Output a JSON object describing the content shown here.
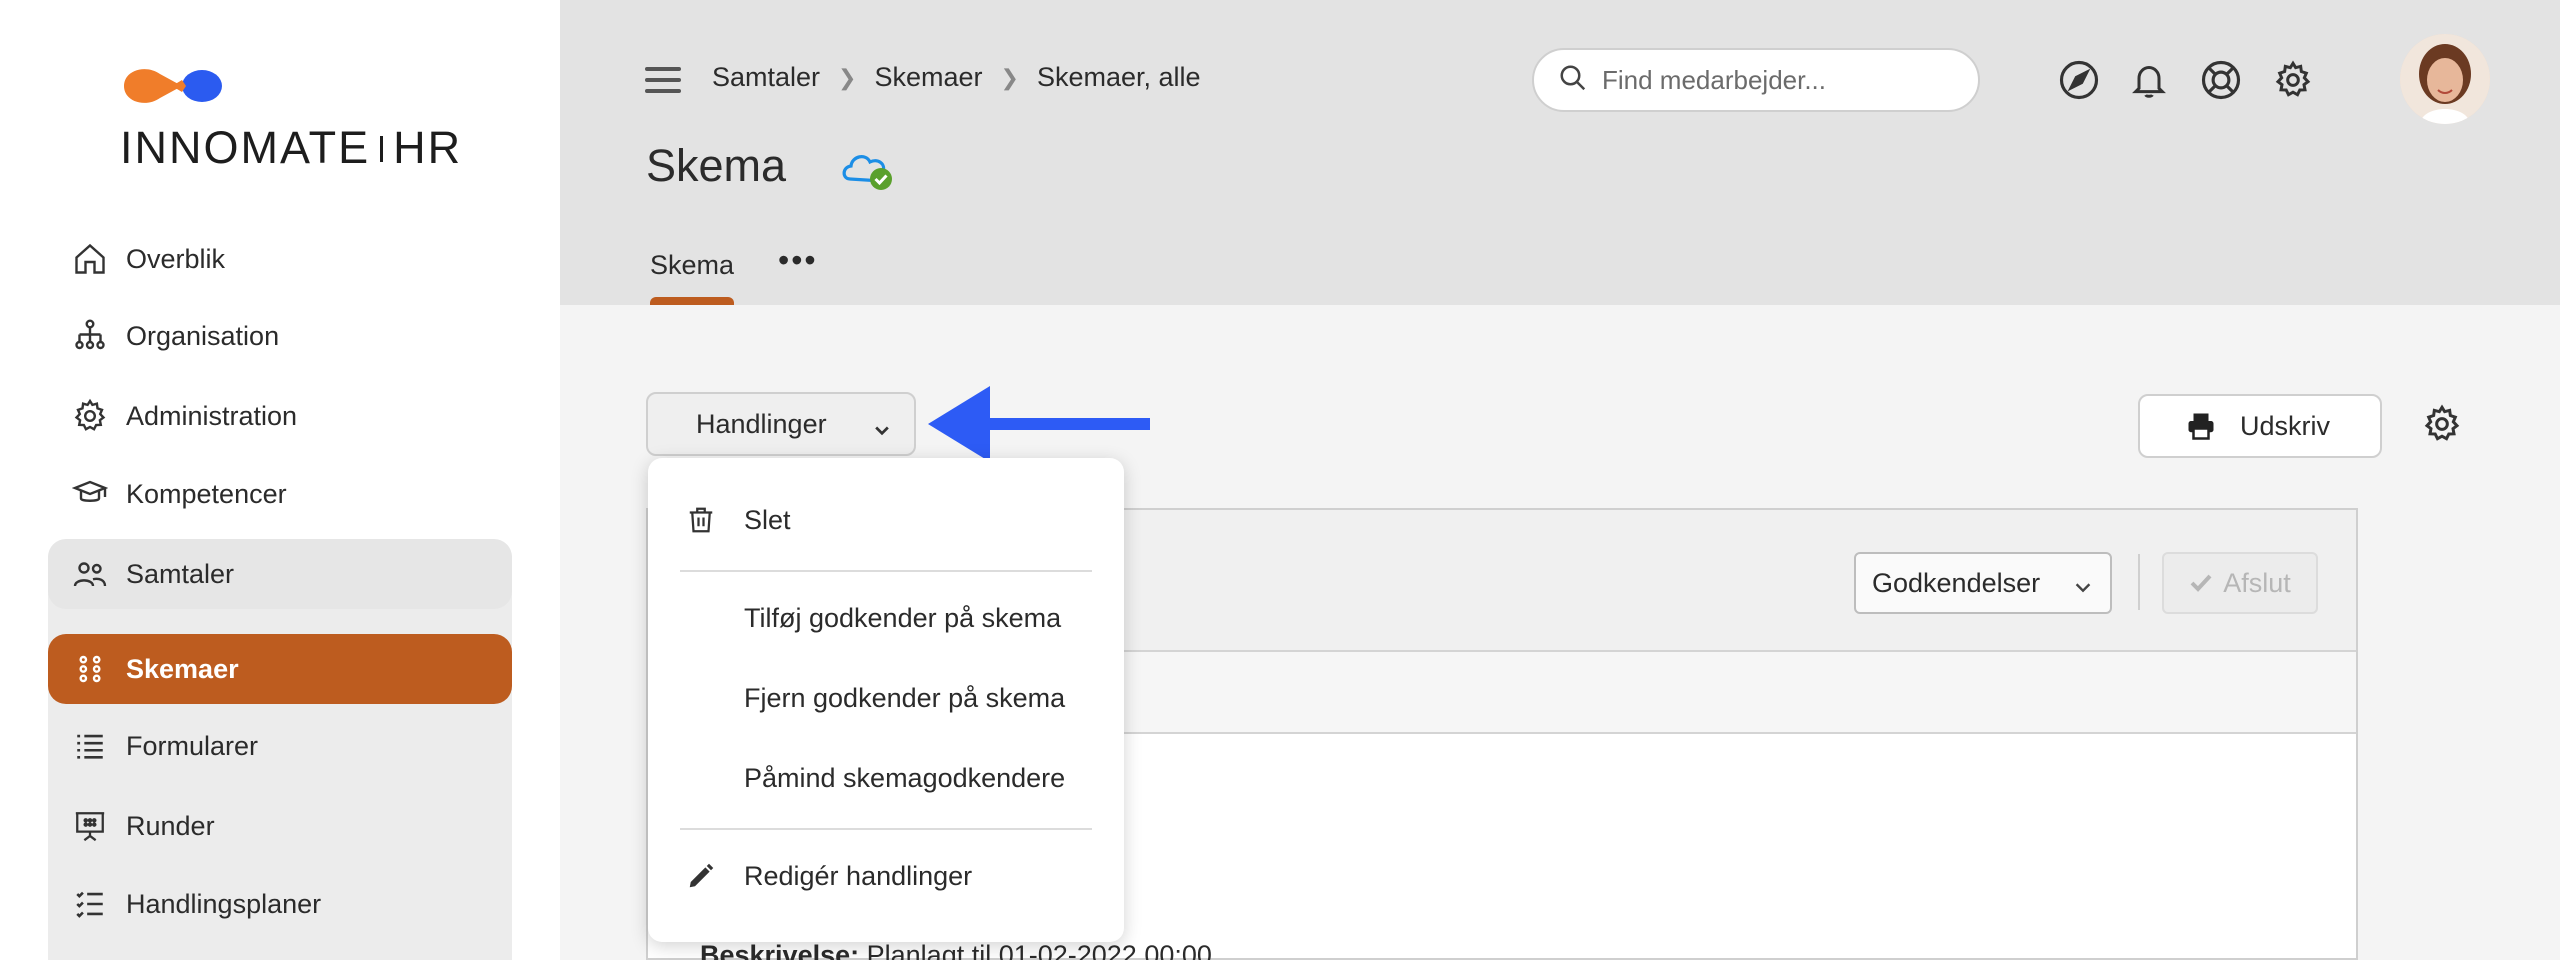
{
  "brand": {
    "name_left": "INNOMATE",
    "name_right": "HR",
    "accent": "#bd5c1f",
    "logo_orange": "#f07d2a",
    "logo_blue": "#2b5bf0"
  },
  "sidebar": {
    "items": [
      {
        "label": "Overblik",
        "icon": "home-icon"
      },
      {
        "label": "Organisation",
        "icon": "org-chart-icon"
      },
      {
        "label": "Administration",
        "icon": "gear-icon"
      },
      {
        "label": "Kompetencer",
        "icon": "graduation-cap-icon"
      },
      {
        "label": "Samtaler",
        "icon": "people-icon",
        "state": "expanded"
      },
      {
        "label": "Skemaer",
        "icon": "dots-grid-icon",
        "state": "active"
      },
      {
        "label": "Formularer",
        "icon": "list-icon"
      },
      {
        "label": "Runder",
        "icon": "presentation-icon"
      },
      {
        "label": "Handlingsplaner",
        "icon": "checklist-icon"
      }
    ]
  },
  "header": {
    "breadcrumb": [
      "Samtaler",
      "Skemaer",
      "Skemaer, alle"
    ],
    "search_placeholder": "Find medarbejder...",
    "icons": [
      "navigate-icon",
      "bell-icon",
      "help-lifebuoy-icon",
      "settings-gear-icon"
    ],
    "page_title": "Skema",
    "tabs": [
      {
        "label": "Skema",
        "active": true
      }
    ],
    "tab_more": "•••"
  },
  "toolbar": {
    "actions_label": "Handlinger",
    "print_label": "Udskriv"
  },
  "menu": {
    "items": [
      {
        "label": "Slet",
        "icon": "trash-icon"
      },
      {
        "label": "Tilføj godkender på skema"
      },
      {
        "label": "Fjern godkender på skema"
      },
      {
        "label": "Påmind skemagodkendere"
      },
      {
        "label": "Redigér handlinger",
        "icon": "pencil-icon"
      }
    ]
  },
  "panel": {
    "approvals_label": "Godkendelser",
    "finish_label": "Afslut",
    "desc_label": "Beskrivelse:",
    "desc_value": "Planlagt til 01-02-2022 00:00"
  }
}
